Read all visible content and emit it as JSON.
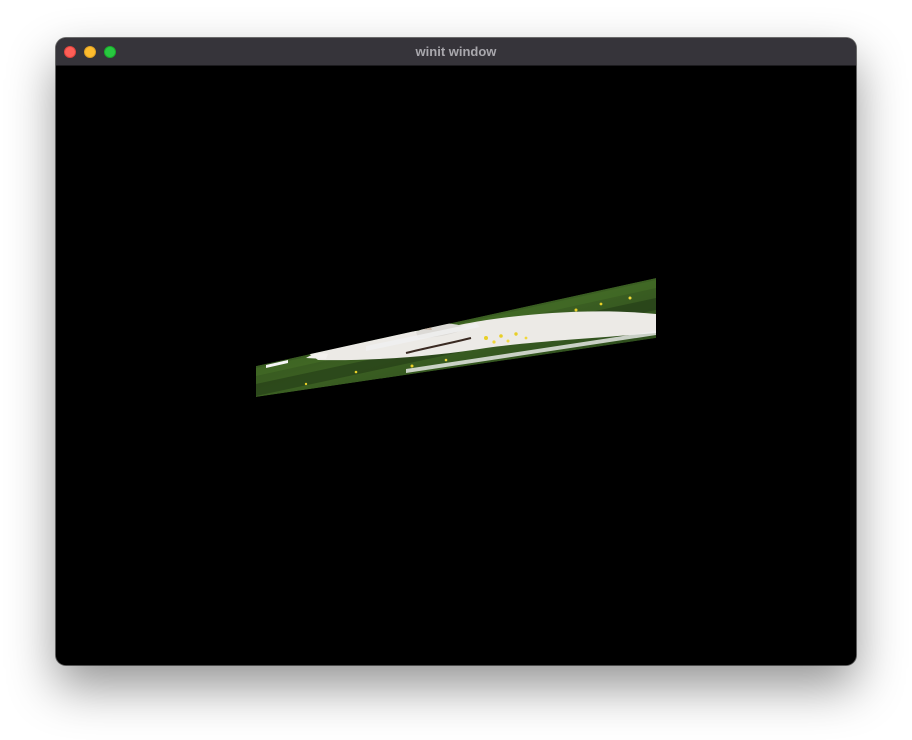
{
  "window": {
    "title": "winit window"
  },
  "controls": {
    "close_color": "#fe5f57",
    "minimize_color": "#febc2e",
    "zoom_color": "#28c840"
  },
  "canvas": {
    "background": "#000000",
    "texture_description_icon": "sheared-dog-on-grass-texture"
  }
}
